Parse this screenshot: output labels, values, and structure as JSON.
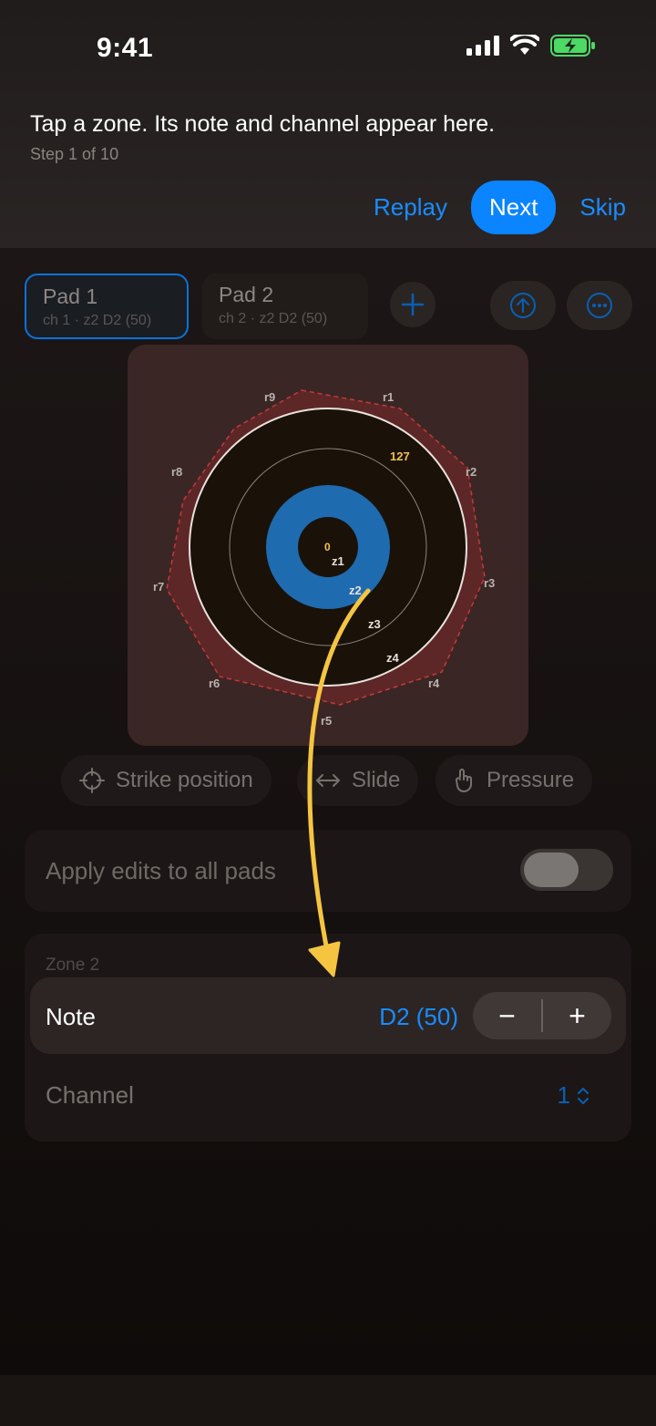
{
  "status_bar": {
    "time": "9:41"
  },
  "coach": {
    "title": "Tap a zone. Its note and channel appear here.",
    "step": "Step 1 of 10",
    "replay_label": "Replay",
    "next_label": "Next",
    "skip_label": "Skip"
  },
  "pads": [
    {
      "name": "Pad 1",
      "sub": "ch 1 · z2 D2 (50)"
    },
    {
      "name": "Pad 2",
      "sub": "ch 2 · z2 D2 (50)"
    }
  ],
  "pad_visual": {
    "rim_labels": [
      "r1",
      "r2",
      "r3",
      "r4",
      "r5",
      "r6",
      "r7",
      "r8",
      "r9"
    ],
    "zone_labels": [
      "z1",
      "z2",
      "z3",
      "z4"
    ],
    "center_value": "0",
    "outer_value": "127"
  },
  "modes": [
    "Strike position",
    "Slide",
    "Pressure"
  ],
  "apply_all": {
    "label": "Apply edits to all pads",
    "on": false
  },
  "zone": {
    "title": "Zone 2",
    "note_label": "Note",
    "note_value": "D2 (50)",
    "minus": "−",
    "plus": "+",
    "channel_label": "Channel",
    "channel_value": "1"
  },
  "colors": {
    "accent": "#0a84ff",
    "highlight_zone": "#1f6bb0",
    "arrow": "#f5c542",
    "rim": "#6b2a2a"
  }
}
